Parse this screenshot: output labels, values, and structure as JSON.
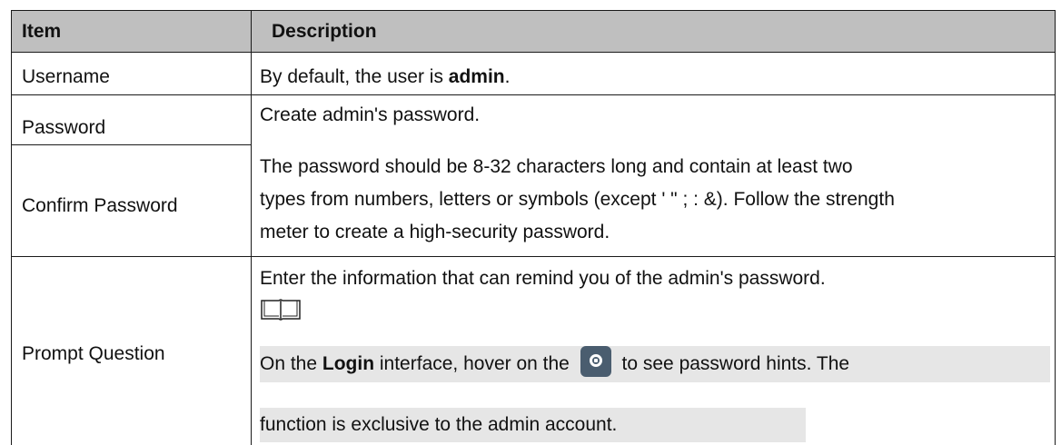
{
  "table": {
    "headers": {
      "item": "Item",
      "description": "Description"
    },
    "rows": {
      "username": {
        "item": "Username",
        "desc_prefix": "By default, the user is ",
        "desc_bold": "admin",
        "desc_suffix": "."
      },
      "password": {
        "item": "Password"
      },
      "confirm_password": {
        "item": "Confirm Password"
      },
      "password_desc": {
        "line1": "Create admin's password.",
        "line2": "The password should be 8-32 characters long and contain at least two",
        "line3": "types from numbers, letters or symbols (except ' \" ; : &). Follow the strength",
        "line4": "meter to create a high-security password."
      },
      "prompt_question": {
        "item": "Prompt Question",
        "line1": "Enter the information that can remind you of the admin's password.",
        "note_icon": "book-note-icon",
        "note_line1_a": "On the ",
        "note_line1_bold": "Login",
        "note_line1_b": " interface, hover on the ",
        "hint_icon": "password-hint-icon",
        "note_line1_c": " to see password hints. The",
        "note_line2": "function is exclusive to the admin account."
      }
    }
  },
  "colors": {
    "header_bg": "#bfbfbf",
    "note_highlight": "#e6e6e6",
    "border": "#1a1a1a",
    "hint_icon_bg": "#4a5d6f"
  }
}
